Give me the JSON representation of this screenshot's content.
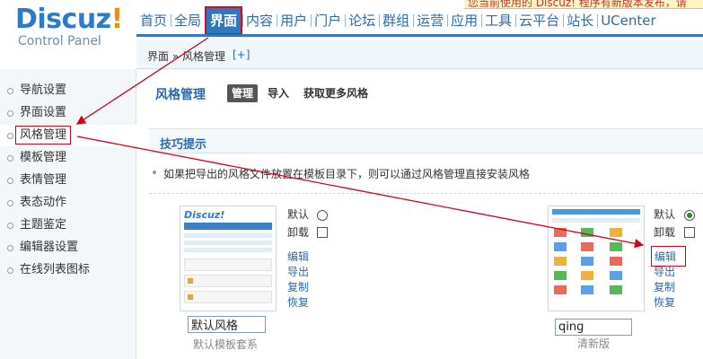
{
  "header": {
    "logo_title": "Discuz",
    "logo_bang": "!",
    "logo_subtitle": "Control Panel",
    "notice_text": "您当前使用的 Discuz! 程序有新版本发布，请"
  },
  "nav": {
    "items": [
      {
        "label": "首页"
      },
      {
        "label": "全局"
      },
      {
        "label": "界面",
        "active": true
      },
      {
        "label": "内容"
      },
      {
        "label": "用户"
      },
      {
        "label": "门户"
      },
      {
        "label": "论坛"
      },
      {
        "label": "群组"
      },
      {
        "label": "运营"
      },
      {
        "label": "应用"
      },
      {
        "label": "工具"
      },
      {
        "label": "云平台"
      },
      {
        "label": "站长"
      },
      {
        "label": "UCenter"
      }
    ]
  },
  "breadcrumb": {
    "text": "界面 » 风格管理",
    "add_label": "[+]"
  },
  "sidebar": {
    "items": [
      {
        "label": "导航设置"
      },
      {
        "label": "界面设置"
      },
      {
        "label": "风格管理",
        "active": true
      },
      {
        "label": "模板管理"
      },
      {
        "label": "表情管理"
      },
      {
        "label": "表态动作"
      },
      {
        "label": "主题鉴定"
      },
      {
        "label": "编辑器设置"
      },
      {
        "label": "在线列表图标"
      }
    ]
  },
  "main": {
    "title": "风格管理",
    "tabs": [
      {
        "label": "管理",
        "active": true
      },
      {
        "label": "导入"
      },
      {
        "label": "获取更多风格"
      }
    ],
    "tips_title": "技巧提示",
    "tip": "如果把导出的风格文件放置在模板目录下，则可以通过风格管理直接安装风格"
  },
  "themes": [
    {
      "name_value": "默认风格",
      "caption": "默认模板套系",
      "default_label": "默认",
      "uninstall_label": "卸载",
      "is_default": false,
      "actions": [
        "编辑",
        "导出",
        "复制",
        "恢复"
      ],
      "thumb_logo": "Discuz!"
    },
    {
      "name_value": "qing",
      "caption": "清新版",
      "default_label": "默认",
      "uninstall_label": "卸载",
      "is_default": true,
      "actions": [
        "编辑",
        "导出",
        "复制",
        "恢复"
      ]
    }
  ],
  "colors": {
    "accent": "#2f78c0",
    "highlight": "#d0021b",
    "link": "#2d6aa8"
  }
}
